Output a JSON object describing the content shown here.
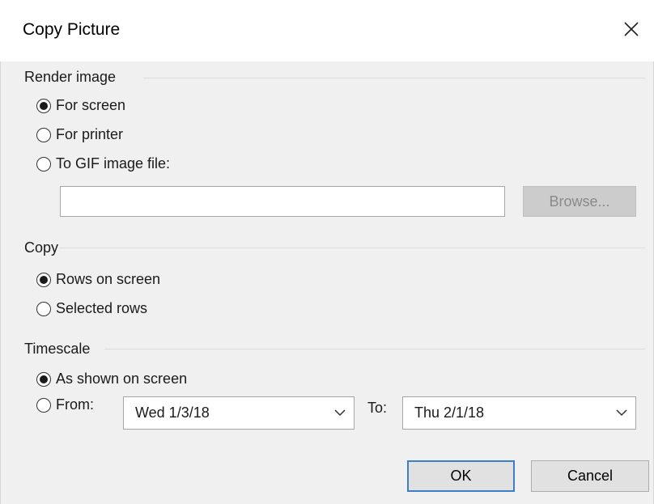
{
  "dialog": {
    "title": "Copy Picture",
    "close_icon": "close-icon"
  },
  "render_image": {
    "label": "Render image",
    "options": [
      {
        "label": "For screen",
        "selected": true
      },
      {
        "label": "For printer",
        "selected": false
      },
      {
        "label": "To GIF image file:",
        "selected": false
      }
    ],
    "file_path": "",
    "browse_label": "Browse...",
    "browse_enabled": false
  },
  "copy": {
    "label": "Copy",
    "options": [
      {
        "label": "Rows on screen",
        "selected": true
      },
      {
        "label": "Selected rows",
        "selected": false
      }
    ]
  },
  "timescale": {
    "label": "Timescale",
    "options": [
      {
        "label": "As shown on screen",
        "selected": true
      },
      {
        "label": "From:",
        "selected": false
      }
    ],
    "from_value": "Wed 1/3/18",
    "to_label": "To:",
    "to_value": "Thu 2/1/18"
  },
  "buttons": {
    "ok_label": "OK",
    "cancel_label": "Cancel"
  },
  "colors": {
    "dialog_body": "#f0f0f0",
    "ok_focus_border": "#3c7fc7",
    "disabled_button": "#cccccc"
  }
}
